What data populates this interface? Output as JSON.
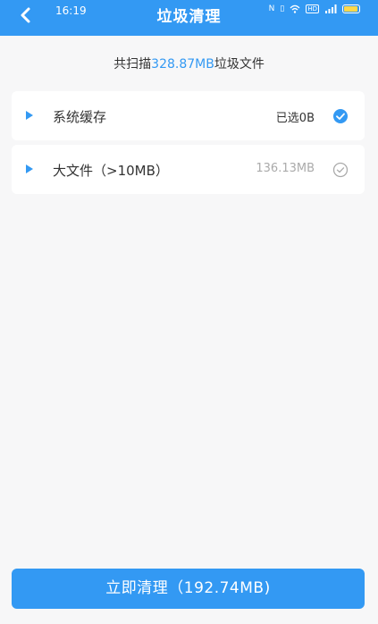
{
  "status_bar": {
    "time": "16:19",
    "icons": [
      "nfc-icon",
      "vibrate-icon",
      "wifi-icon",
      "hd-icon",
      "signal-icon",
      "battery-icon"
    ]
  },
  "header": {
    "title": "垃圾清理",
    "back_icon": "back-arrow-icon"
  },
  "summary": {
    "prefix": "共扫描",
    "size": "328.87MB",
    "suffix": "垃圾文件"
  },
  "items": [
    {
      "label": "系统缓存",
      "value": "已选0B",
      "checked": true
    },
    {
      "label": "大文件（>10MB）",
      "value": "136.13MB",
      "checked": false
    }
  ],
  "clean_button": {
    "label": "立即清理（192.74MB)"
  },
  "colors": {
    "primary": "#3399f3",
    "background": "#f7f7f8",
    "muted": "#aaaaaa"
  }
}
